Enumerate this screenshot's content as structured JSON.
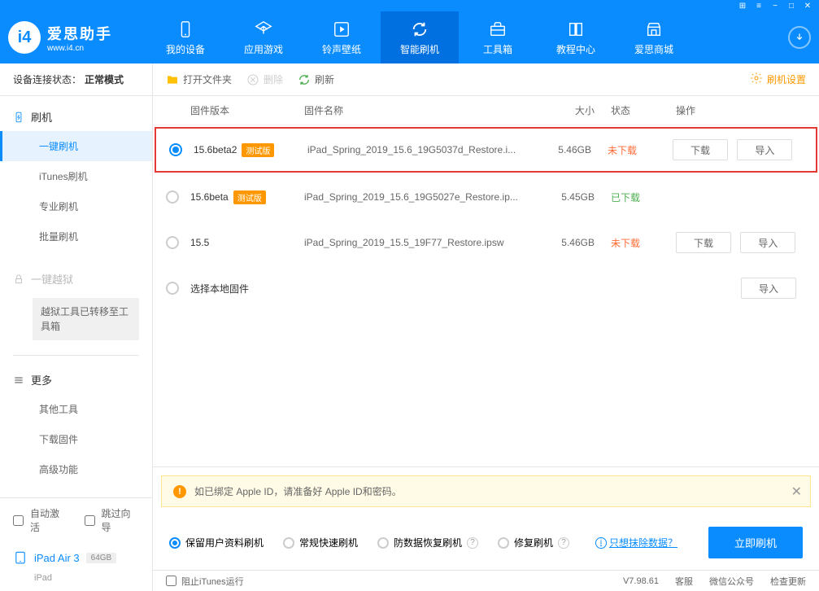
{
  "app": {
    "name": "爱思助手",
    "url": "www.i4.cn"
  },
  "nav": [
    {
      "label": "我的设备",
      "icon": "device"
    },
    {
      "label": "应用游戏",
      "icon": "apps"
    },
    {
      "label": "铃声壁纸",
      "icon": "music"
    },
    {
      "label": "智能刷机",
      "icon": "refresh"
    },
    {
      "label": "工具箱",
      "icon": "toolbox"
    },
    {
      "label": "教程中心",
      "icon": "book"
    },
    {
      "label": "爱思商城",
      "icon": "store"
    }
  ],
  "sidebar": {
    "status_label": "设备连接状态：",
    "status_value": "正常模式",
    "flash": {
      "header": "刷机",
      "items": [
        "一键刷机",
        "iTunes刷机",
        "专业刷机",
        "批量刷机"
      ]
    },
    "jailbreak": {
      "header": "一键越狱",
      "notice": "越狱工具已转移至工具箱"
    },
    "more": {
      "header": "更多",
      "items": [
        "其他工具",
        "下载固件",
        "高级功能"
      ]
    },
    "auto_activate": "自动激活",
    "skip_guide": "跳过向导",
    "device": {
      "name": "iPad Air 3",
      "badge": "64GB",
      "type": "iPad"
    }
  },
  "toolbar": {
    "open_folder": "打开文件夹",
    "delete": "删除",
    "refresh": "刷新",
    "settings": "刷机设置"
  },
  "table": {
    "headers": {
      "version": "固件版本",
      "name": "固件名称",
      "size": "大小",
      "status": "状态",
      "actions": "操作"
    },
    "rows": [
      {
        "version": "15.6beta2",
        "beta": true,
        "name": "iPad_Spring_2019_15.6_19G5037d_Restore.i...",
        "size": "5.46GB",
        "status": "未下载",
        "status_color": "red",
        "selected": true,
        "actions": [
          "下载",
          "导入"
        ]
      },
      {
        "version": "15.6beta",
        "beta": true,
        "name": "iPad_Spring_2019_15.6_19G5027e_Restore.ip...",
        "size": "5.45GB",
        "status": "已下载",
        "status_color": "green",
        "selected": false,
        "actions": []
      },
      {
        "version": "15.5",
        "beta": false,
        "name": "iPad_Spring_2019_15.5_19F77_Restore.ipsw",
        "size": "5.46GB",
        "status": "未下载",
        "status_color": "red",
        "selected": false,
        "actions": [
          "下载",
          "导入"
        ]
      },
      {
        "version": "选择本地固件",
        "beta": false,
        "name": "",
        "size": "",
        "status": "",
        "status_color": "",
        "selected": false,
        "actions": [
          "导入"
        ],
        "local": true
      }
    ],
    "beta_tag": "测试版"
  },
  "bottom": {
    "warning": "如已绑定 Apple ID，请准备好 Apple ID和密码。",
    "options": [
      {
        "label": "保留用户资料刷机",
        "checked": true,
        "help": false
      },
      {
        "label": "常规快速刷机",
        "checked": false,
        "help": false
      },
      {
        "label": "防数据恢复刷机",
        "checked": false,
        "help": true
      },
      {
        "label": "修复刷机",
        "checked": false,
        "help": true
      }
    ],
    "erase_link": "只想抹除数据？",
    "flash_btn": "立即刷机"
  },
  "statusbar": {
    "block_itunes": "阻止iTunes运行",
    "version": "V7.98.61",
    "links": [
      "客服",
      "微信公众号",
      "检查更新"
    ]
  }
}
